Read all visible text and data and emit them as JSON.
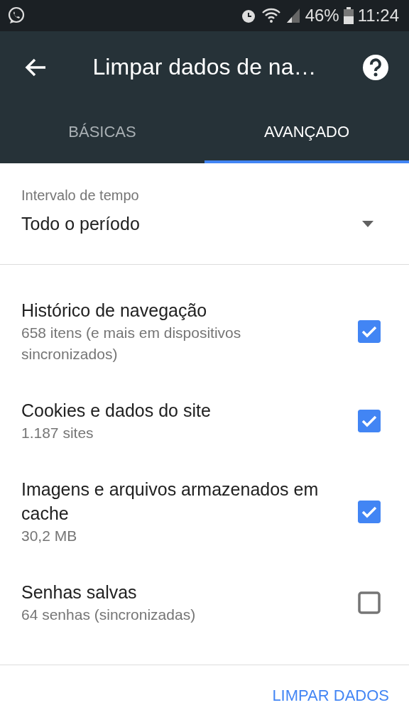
{
  "status_bar": {
    "battery": "46%",
    "time": "11:24"
  },
  "toolbar": {
    "title": "Limpar dados de na…"
  },
  "tabs": [
    {
      "label": "BÁSICAS",
      "selected": false
    },
    {
      "label": "AVANÇADO",
      "selected": true
    }
  ],
  "time_range": {
    "label": "Intervalo de tempo",
    "value": "Todo o período"
  },
  "items": [
    {
      "title": "Histórico de navegação",
      "subtitle": "658 itens (e mais em dispositivos sincronizados)",
      "checked": true
    },
    {
      "title": "Cookies e dados do site",
      "subtitle": "1.187 sites",
      "checked": true
    },
    {
      "title": "Imagens e arquivos armazenados em cache",
      "subtitle": "30,2 MB",
      "checked": true
    },
    {
      "title": "Senhas salvas",
      "subtitle": "64 senhas (sincronizadas)",
      "checked": false
    }
  ],
  "action": "LIMPAR DADOS"
}
